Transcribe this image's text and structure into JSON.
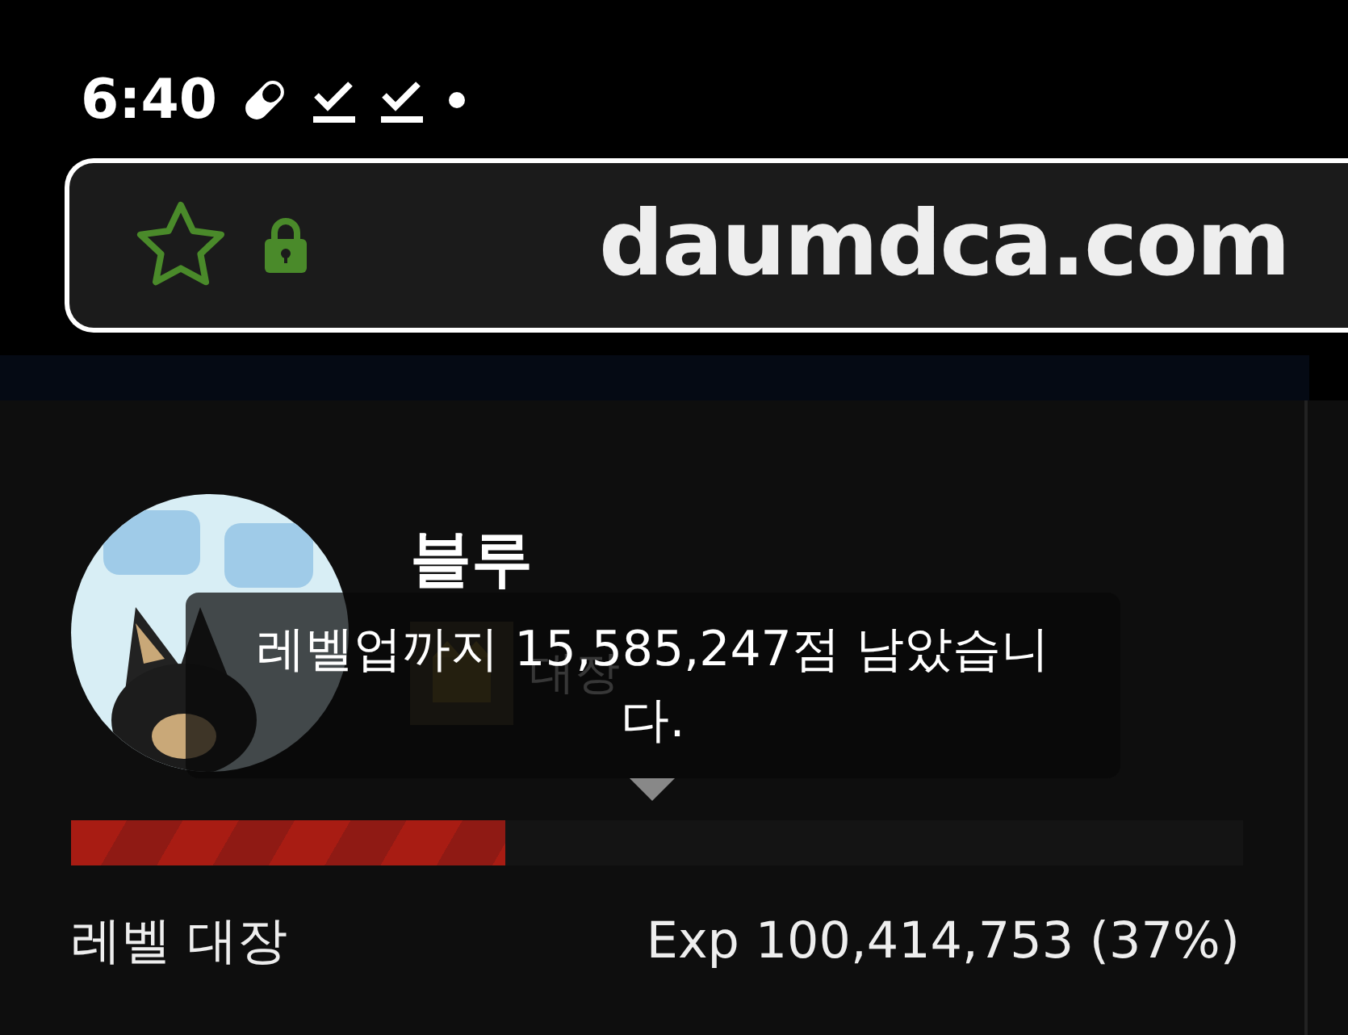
{
  "status_bar": {
    "time": "6:40"
  },
  "address_bar": {
    "url": "daumdca.com",
    "bookmarked": false,
    "secure": true
  },
  "profile": {
    "name": "블루",
    "rank_label": "대장",
    "level": 0.37,
    "level_text": "레벨 대장",
    "exp_text": "Exp 100,414,753 (37%)"
  },
  "tooltip": {
    "text": "레벨업까지 15,585,247점 남았습니다."
  }
}
